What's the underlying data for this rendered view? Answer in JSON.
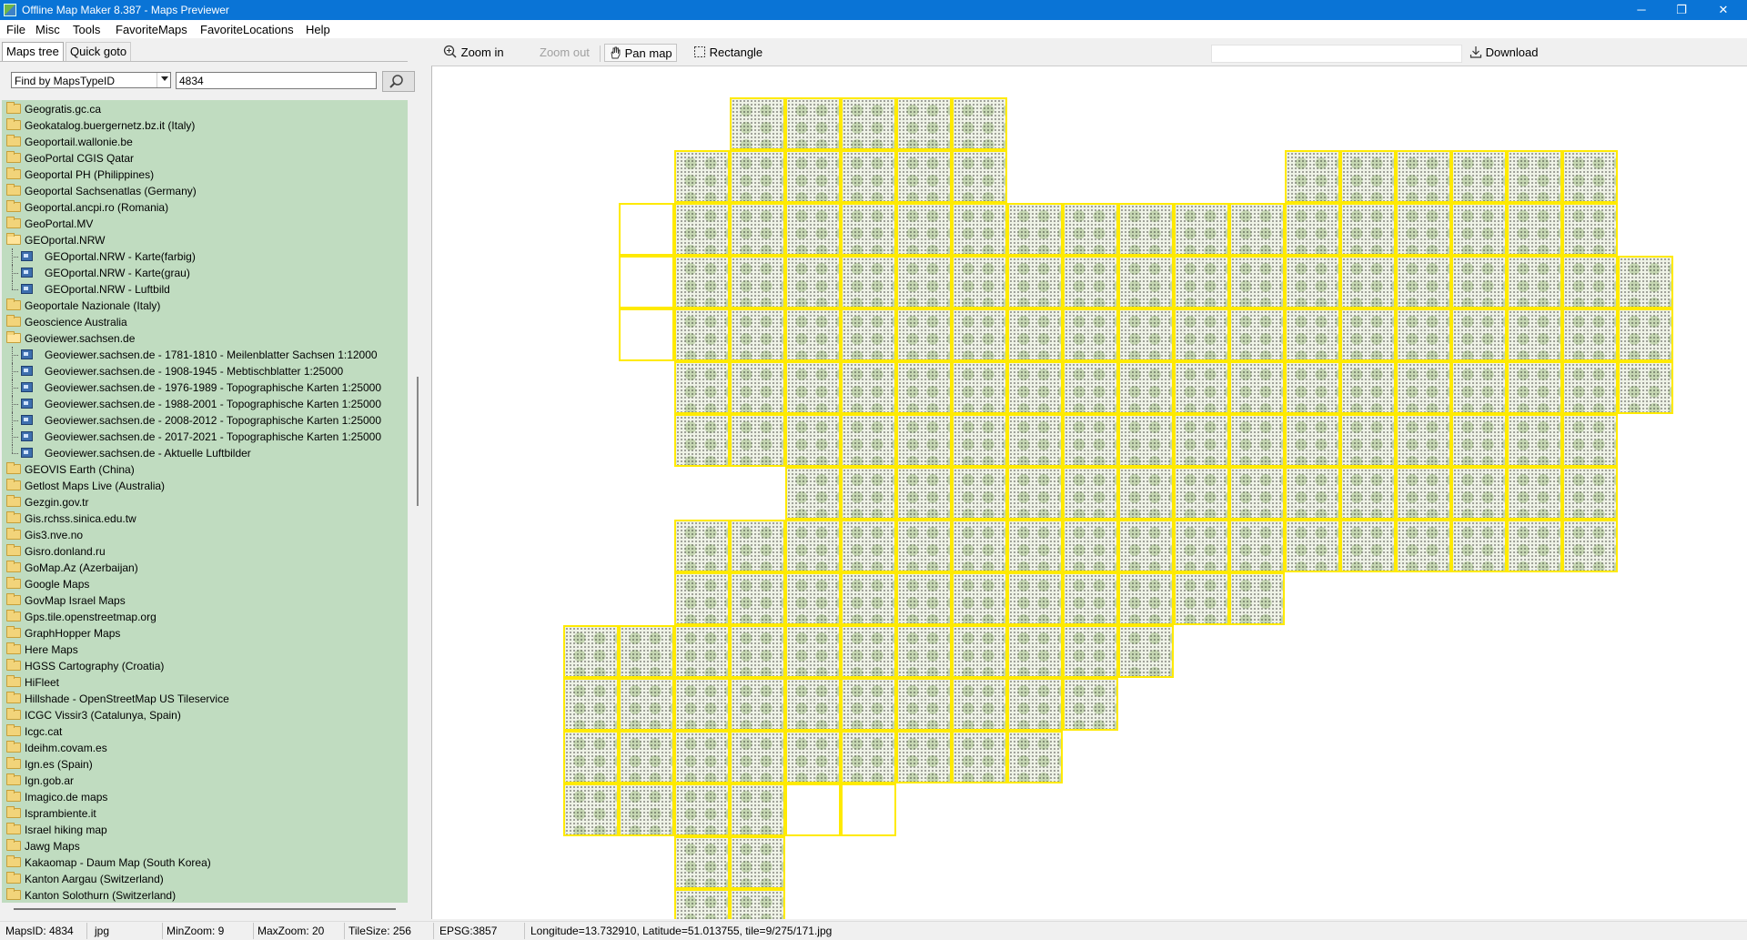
{
  "window": {
    "title": "Offline Map Maker 8.387 - Maps Previewer",
    "min": "─",
    "max": "❐",
    "close": "✕"
  },
  "menu": [
    "File",
    "Misc",
    "Tools",
    "FavoriteMaps",
    "FavoriteLocations",
    "Help"
  ],
  "tabs": {
    "maps_tree": "Maps tree",
    "quick_goto": "Quick goto"
  },
  "search": {
    "mode": "Find by MapsTypeID",
    "value": "4834"
  },
  "tree": [
    {
      "label": "Geogratis.gc.ca",
      "type": "folder",
      "level": 0
    },
    {
      "label": "Geokatalog.buergernetz.bz.it (Italy)",
      "type": "folder",
      "level": 0
    },
    {
      "label": "Geoportail.wallonie.be",
      "type": "folder",
      "level": 0
    },
    {
      "label": "GeoPortal CGIS Qatar",
      "type": "folder",
      "level": 0
    },
    {
      "label": "Geoportal PH (Philippines)",
      "type": "folder",
      "level": 0
    },
    {
      "label": "Geoportal Sachsenatlas (Germany)",
      "type": "folder",
      "level": 0
    },
    {
      "label": "Geoportal.ancpi.ro (Romania)",
      "type": "folder",
      "level": 0
    },
    {
      "label": "GeoPortal.MV",
      "type": "folder",
      "level": 0
    },
    {
      "label": "GEOportal.NRW",
      "type": "folder-open",
      "level": 0
    },
    {
      "label": "GEOportal.NRW - Karte(farbig)",
      "type": "map",
      "level": 1
    },
    {
      "label": "GEOportal.NRW - Karte(grau)",
      "type": "map",
      "level": 1
    },
    {
      "label": "GEOportal.NRW - Luftbild",
      "type": "map",
      "level": 1,
      "last": true
    },
    {
      "label": "Geoportale Nazionale (Italy)",
      "type": "folder",
      "level": 0
    },
    {
      "label": "Geoscience Australia",
      "type": "folder",
      "level": 0
    },
    {
      "label": "Geoviewer.sachsen.de",
      "type": "folder-open",
      "level": 0
    },
    {
      "label": "Geoviewer.sachsen.de - 1781-1810 - Meilenblatter Sachsen 1:12000",
      "type": "map",
      "level": 1
    },
    {
      "label": "Geoviewer.sachsen.de - 1908-1945 - Mebtischblatter 1:25000",
      "type": "map",
      "level": 1
    },
    {
      "label": "Geoviewer.sachsen.de - 1976-1989 - Topographische Karten 1:25000",
      "type": "map",
      "level": 1
    },
    {
      "label": "Geoviewer.sachsen.de - 1988-2001 - Topographische Karten 1:25000",
      "type": "map",
      "level": 1
    },
    {
      "label": "Geoviewer.sachsen.de - 2008-2012 - Topographische Karten 1:25000",
      "type": "map",
      "level": 1
    },
    {
      "label": "Geoviewer.sachsen.de - 2017-2021 - Topographische Karten 1:25000",
      "type": "map",
      "level": 1
    },
    {
      "label": "Geoviewer.sachsen.de - Aktuelle Luftbilder",
      "type": "map",
      "level": 1,
      "last": true
    },
    {
      "label": "GEOVIS Earth (China)",
      "type": "folder",
      "level": 0
    },
    {
      "label": "Getlost Maps Live (Australia)",
      "type": "folder",
      "level": 0
    },
    {
      "label": "Gezgin.gov.tr",
      "type": "folder",
      "level": 0
    },
    {
      "label": "Gis.rchss.sinica.edu.tw",
      "type": "folder",
      "level": 0
    },
    {
      "label": "Gis3.nve.no",
      "type": "folder",
      "level": 0
    },
    {
      "label": "Gisro.donland.ru",
      "type": "folder",
      "level": 0
    },
    {
      "label": "GoMap.Az (Azerbaijan)",
      "type": "folder",
      "level": 0
    },
    {
      "label": "Google Maps",
      "type": "folder",
      "level": 0
    },
    {
      "label": "GovMap Israel Maps",
      "type": "folder",
      "level": 0
    },
    {
      "label": "Gps.tile.openstreetmap.org",
      "type": "folder",
      "level": 0
    },
    {
      "label": "GraphHopper Maps",
      "type": "folder",
      "level": 0
    },
    {
      "label": "Here Maps",
      "type": "folder",
      "level": 0
    },
    {
      "label": "HGSS Cartography (Croatia)",
      "type": "folder",
      "level": 0
    },
    {
      "label": "HiFleet",
      "type": "folder",
      "level": 0
    },
    {
      "label": "Hillshade - OpenStreetMap US Tileservice",
      "type": "folder",
      "level": 0
    },
    {
      "label": "ICGC Vissir3 (Catalunya, Spain)",
      "type": "folder",
      "level": 0
    },
    {
      "label": "Icgc.cat",
      "type": "folder",
      "level": 0
    },
    {
      "label": "Ideihm.covam.es",
      "type": "folder",
      "level": 0
    },
    {
      "label": "Ign.es (Spain)",
      "type": "folder",
      "level": 0
    },
    {
      "label": "Ign.gob.ar",
      "type": "folder",
      "level": 0
    },
    {
      "label": "Imagico.de maps",
      "type": "folder",
      "level": 0
    },
    {
      "label": "Isprambiente.it",
      "type": "folder",
      "level": 0
    },
    {
      "label": "Israel hiking map",
      "type": "folder",
      "level": 0
    },
    {
      "label": "Jawg Maps",
      "type": "folder",
      "level": 0
    },
    {
      "label": "Kakaomap - Daum Map (South Korea)",
      "type": "folder",
      "level": 0
    },
    {
      "label": "Kanton Aargau (Switzerland)",
      "type": "folder",
      "level": 0
    },
    {
      "label": "Kanton Solothurn (Switzerland)",
      "type": "folder",
      "level": 0
    }
  ],
  "toolbar": {
    "zoom_in": "Zoom in",
    "zoom_out": "Zoom out",
    "pan_map": "Pan map",
    "rectangle": "Rectangle",
    "download": "Download"
  },
  "map": {
    "tile_color": "#ffea00",
    "coverage_rows": [
      {
        "row": 0,
        "from": 3,
        "to": 7
      },
      {
        "row": 1,
        "from": 2,
        "to": 7,
        "extra": [
          {
            "from": 13,
            "to": 18
          }
        ]
      },
      {
        "row": 2,
        "from": 1,
        "to": 18,
        "empty": [
          1
        ]
      },
      {
        "row": 3,
        "from": 1,
        "to": 19,
        "empty": [
          1
        ]
      },
      {
        "row": 4,
        "from": 1,
        "to": 19,
        "empty": [
          1
        ]
      },
      {
        "row": 5,
        "from": 2,
        "to": 19
      },
      {
        "row": 6,
        "from": 2,
        "to": 18
      },
      {
        "row": 7,
        "from": 4,
        "to": 18
      },
      {
        "row": 8,
        "from": 2,
        "to": 18
      },
      {
        "row": 9,
        "from": 2,
        "to": 12
      },
      {
        "row": 10,
        "from": 0,
        "to": 10
      },
      {
        "row": 11,
        "from": 0,
        "to": 9
      },
      {
        "row": 12,
        "from": 0,
        "to": 8
      },
      {
        "row": 13,
        "from": 0,
        "to": 5,
        "empty": [
          4,
          5
        ]
      },
      {
        "row": 14,
        "from": 2,
        "to": 3
      },
      {
        "row": 15,
        "from": 2,
        "to": 3
      }
    ]
  },
  "status": {
    "maps_id": "MapsID: 4834",
    "format": "jpg",
    "min_zoom": "MinZoom: 9",
    "max_zoom": "MaxZoom: 20",
    "tile_size": "TileSize: 256",
    "epsg": "EPSG:3857",
    "coords": "Longitude=13.732910, Latitude=51.013755, tile=9/275/171.jpg"
  }
}
